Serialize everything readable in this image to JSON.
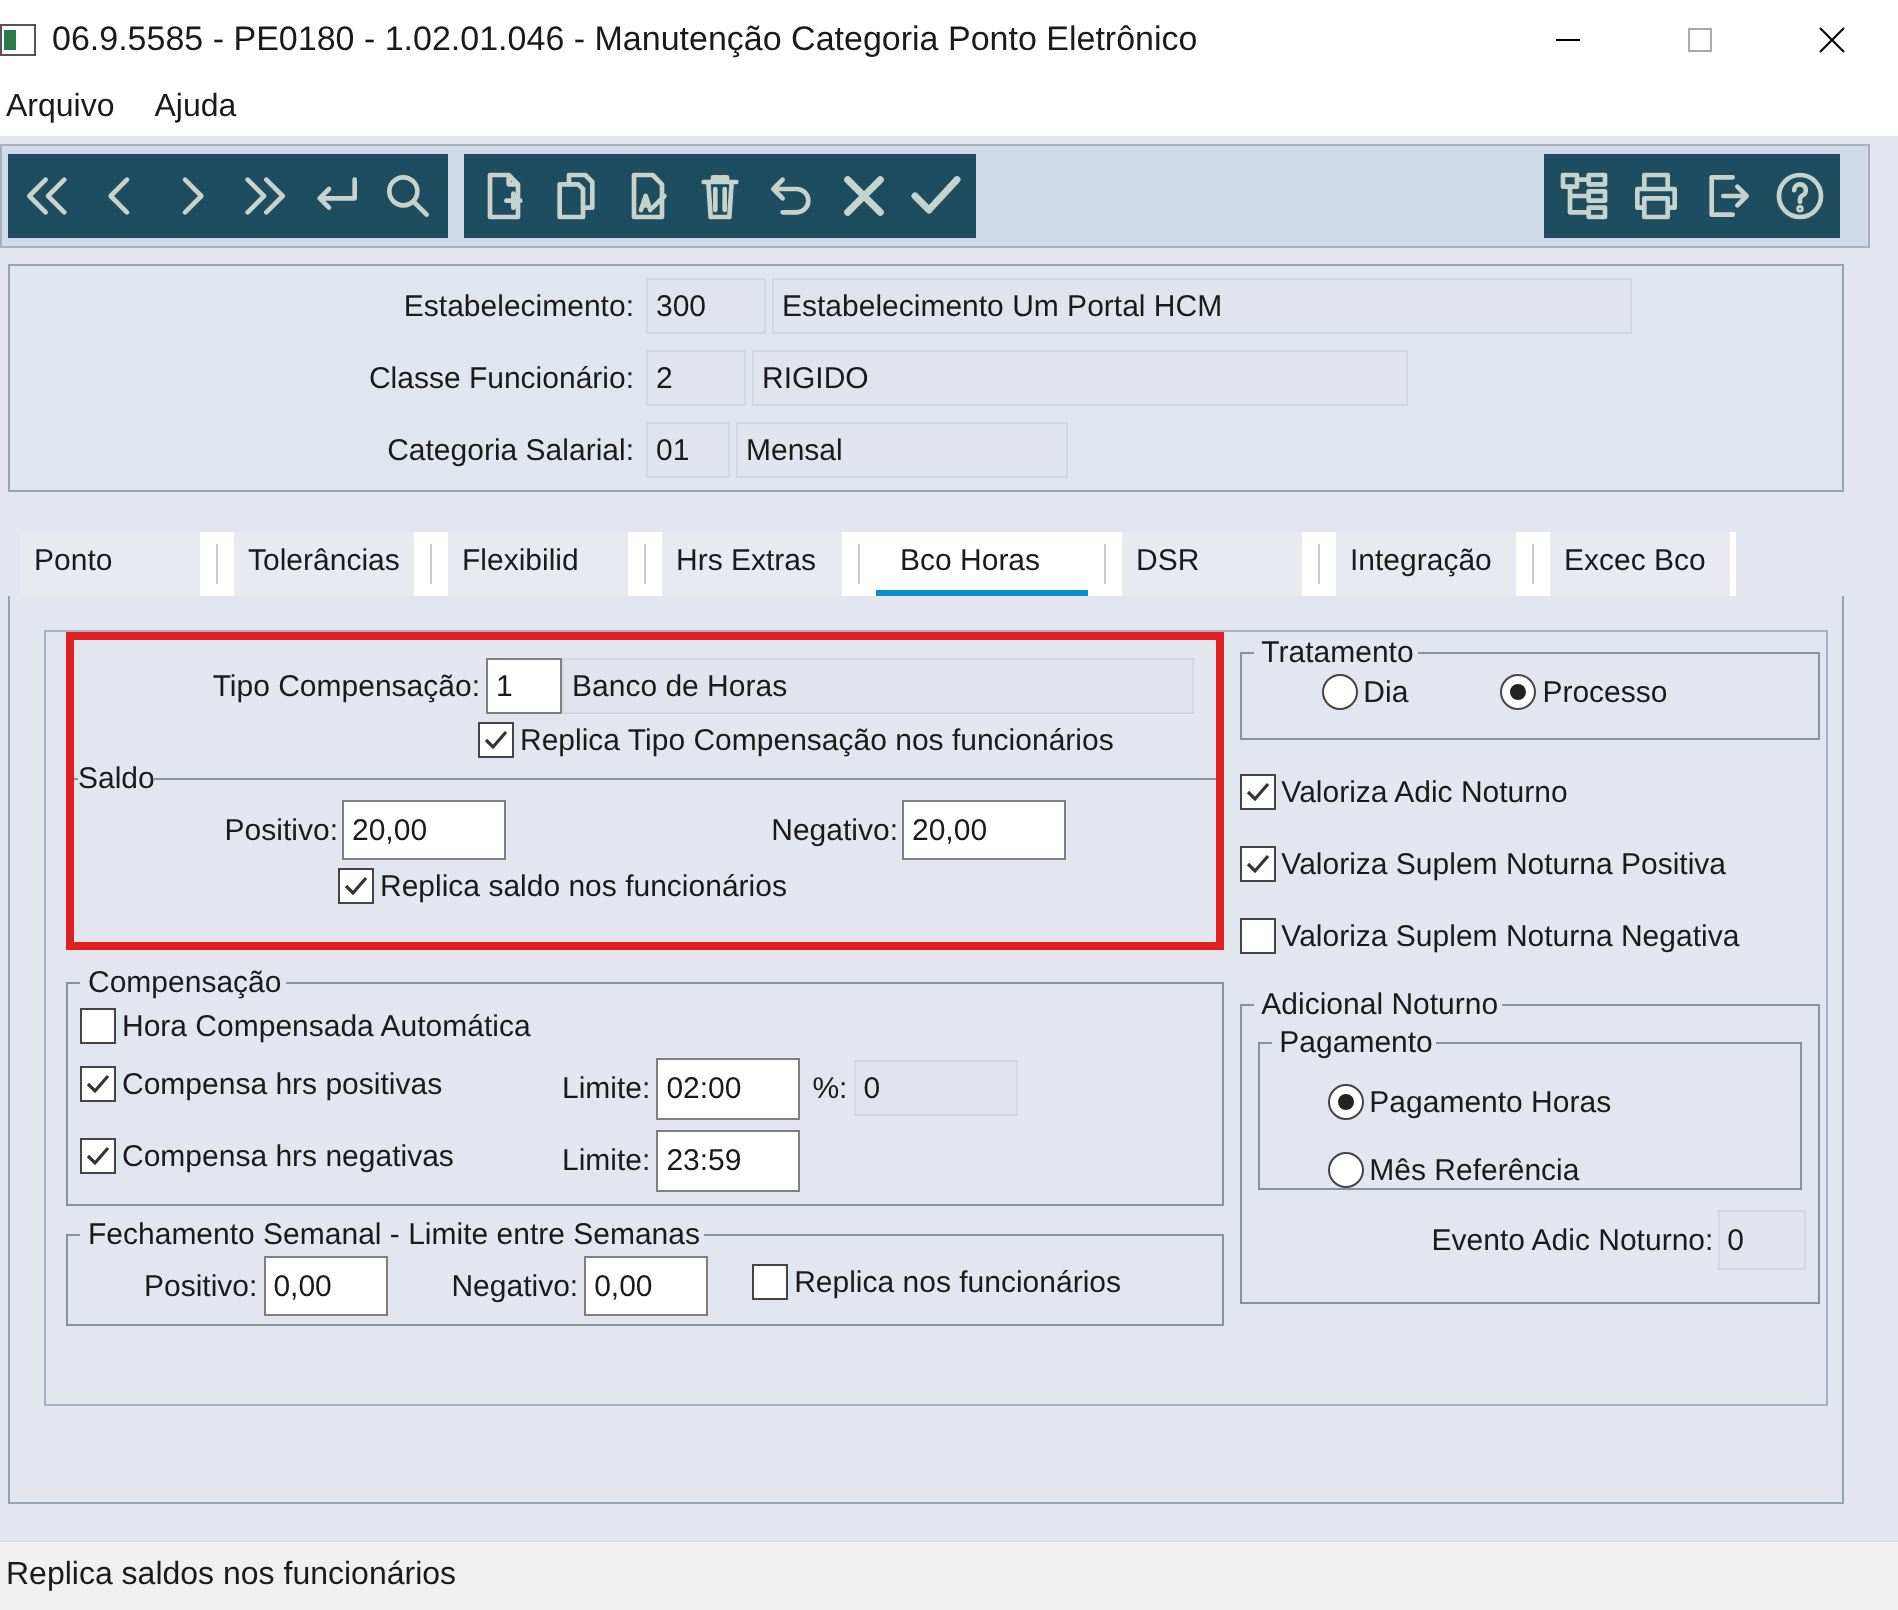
{
  "window": {
    "title": "06.9.5585 - PE0180 - 1.02.01.046 - Manutenção Categoria Ponto Eletrônico"
  },
  "menu": [
    "Arquivo",
    "Ajuda"
  ],
  "header": [
    {
      "label": "Estabelecimento:",
      "code": {
        "value": "300",
        "disabled": true
      },
      "description": {
        "value": "Estabelecimento Um Portal HCM",
        "disabled": true
      }
    },
    {
      "label": "Classe Funcionário:",
      "code": {
        "value": "2",
        "disabled": true
      },
      "description": {
        "value": "RIGIDO",
        "disabled": true
      }
    },
    {
      "label": "Categoria Salarial:",
      "code": {
        "value": "01",
        "disabled": true
      },
      "description": {
        "value": "Mensal",
        "disabled": true
      }
    }
  ],
  "tabs": [
    {
      "label": "Ponto",
      "selected": false
    },
    {
      "label": "Tolerâncias",
      "selected": false
    },
    {
      "label": "Flexibilid",
      "selected": false
    },
    {
      "label": "Hrs Extras",
      "selected": false
    },
    {
      "label": "Bco Horas",
      "selected": true
    },
    {
      "label": "DSR",
      "selected": false
    },
    {
      "label": "Integração",
      "selected": false
    },
    {
      "label": "Excec Bco",
      "selected": false
    }
  ],
  "tipo_compensacao": {
    "label": "Tipo Compensação:",
    "code": {
      "value": "1",
      "disabled": false
    },
    "description": {
      "value": "Banco de Horas",
      "disabled": true
    },
    "replica": {
      "label": "Replica Tipo Compensação nos funcionários",
      "checked": true
    }
  },
  "saldo": {
    "title": "Saldo",
    "positivo": {
      "label": "Positivo:",
      "value": "20,00",
      "disabled": false
    },
    "negativo": {
      "label": "Negativo:",
      "value": "20,00",
      "disabled": false
    },
    "replica": {
      "label": "Replica saldo nos funcionários",
      "checked": true
    }
  },
  "compensacao": {
    "title": "Compensação",
    "automatica": {
      "label": "Hora Compensada Automática",
      "checked": false
    },
    "positivas": {
      "label": "Compensa hrs positivas",
      "checked": true,
      "limit_label": "Limite:",
      "limit": {
        "value": "02:00",
        "disabled": false
      },
      "pct_label": "%:",
      "pct": {
        "value": "0",
        "disabled": true
      }
    },
    "negativas": {
      "label": "Compensa hrs negativas",
      "checked": true,
      "limit_label": "Limite:",
      "limit": {
        "value": "23:59",
        "disabled": false
      }
    }
  },
  "fechamento": {
    "title": "Fechamento Semanal - Limite entre Semanas",
    "positivo": {
      "label": "Positivo:",
      "value": "0,00",
      "disabled": false
    },
    "negativo": {
      "label": "Negativo:",
      "value": "0,00",
      "disabled": false
    },
    "replica": {
      "label": "Replica nos funcionários",
      "checked": false
    }
  },
  "tratamento": {
    "title": "Tratamento",
    "options": [
      {
        "label": "Dia",
        "selected": false
      },
      {
        "label": "Processo",
        "selected": true
      }
    ]
  },
  "valoriza": [
    {
      "label": "Valoriza Adic Noturno",
      "checked": true
    },
    {
      "label": "Valoriza Suplem Noturna Positiva",
      "checked": true
    },
    {
      "label": "Valoriza Suplem Noturna Negativa",
      "checked": false
    }
  ],
  "adicional_noturno": {
    "title": "Adicional Noturno",
    "pagamento": {
      "title": "Pagamento",
      "options": [
        {
          "label": "Pagamento Horas",
          "selected": true
        },
        {
          "label": "Mês Referência",
          "selected": false
        }
      ]
    },
    "evento": {
      "label": "Evento Adic Noturno:",
      "value": "0",
      "disabled": true
    }
  },
  "status_bar": "Replica saldos nos funcionários"
}
